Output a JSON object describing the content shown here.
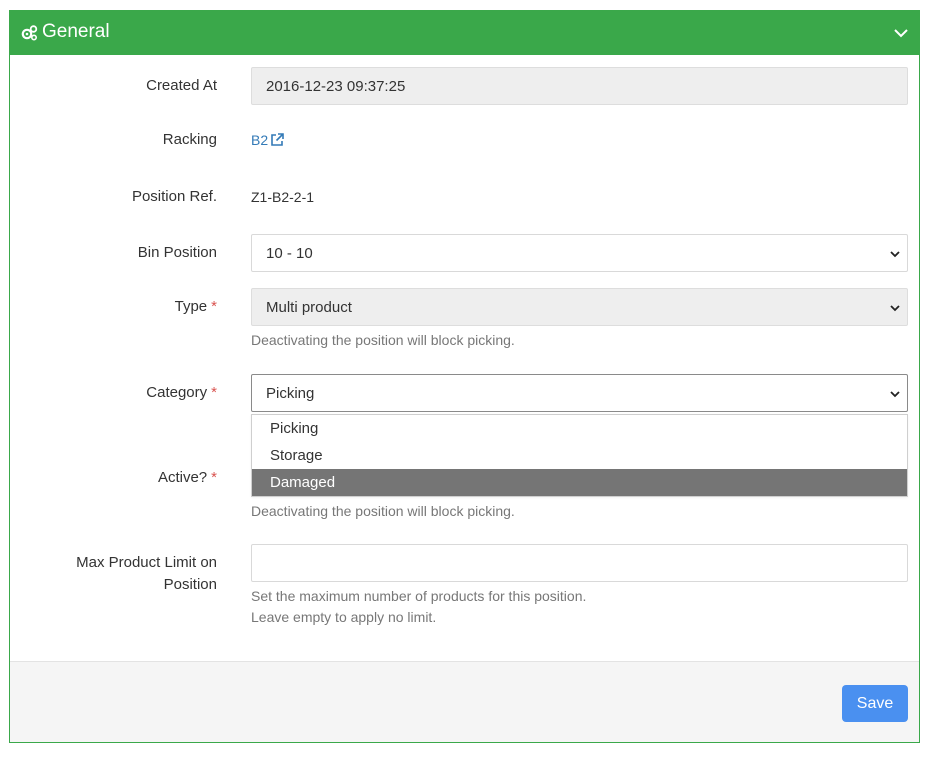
{
  "panel": {
    "title": "General",
    "header_icon": "gears-icon",
    "collapse_icon": "chevron-down-icon",
    "accent_color": "#3aa84a"
  },
  "fields": {
    "created_at": {
      "label": "Created At",
      "value": "2016-12-23 09:37:25"
    },
    "racking": {
      "label": "Racking",
      "link_text": "B2",
      "link_icon": "external-link-icon"
    },
    "position_ref": {
      "label": "Position Ref.",
      "value": "Z1-B2-2-1"
    },
    "bin_position": {
      "label": "Bin Position",
      "value": "10 - 10"
    },
    "type": {
      "label": "Type",
      "required_mark": "*",
      "value": "Multi product",
      "help": "Deactivating the position will block picking."
    },
    "category": {
      "label": "Category",
      "required_mark": "*",
      "value": "Picking",
      "options": [
        "Picking",
        "Storage",
        "Damaged"
      ],
      "highlighted_option": "Damaged"
    },
    "active": {
      "label": "Active?",
      "required_mark": "*",
      "help": "Deactivating the position will block picking."
    },
    "max_product_limit": {
      "label_line1": "Max Product Limit on",
      "label_line2": "Position",
      "value": "",
      "help_line1": "Set the maximum number of products for this position.",
      "help_line2": "Leave empty to apply no limit."
    }
  },
  "footer": {
    "save_label": "Save",
    "save_color": "#4a90f0"
  }
}
